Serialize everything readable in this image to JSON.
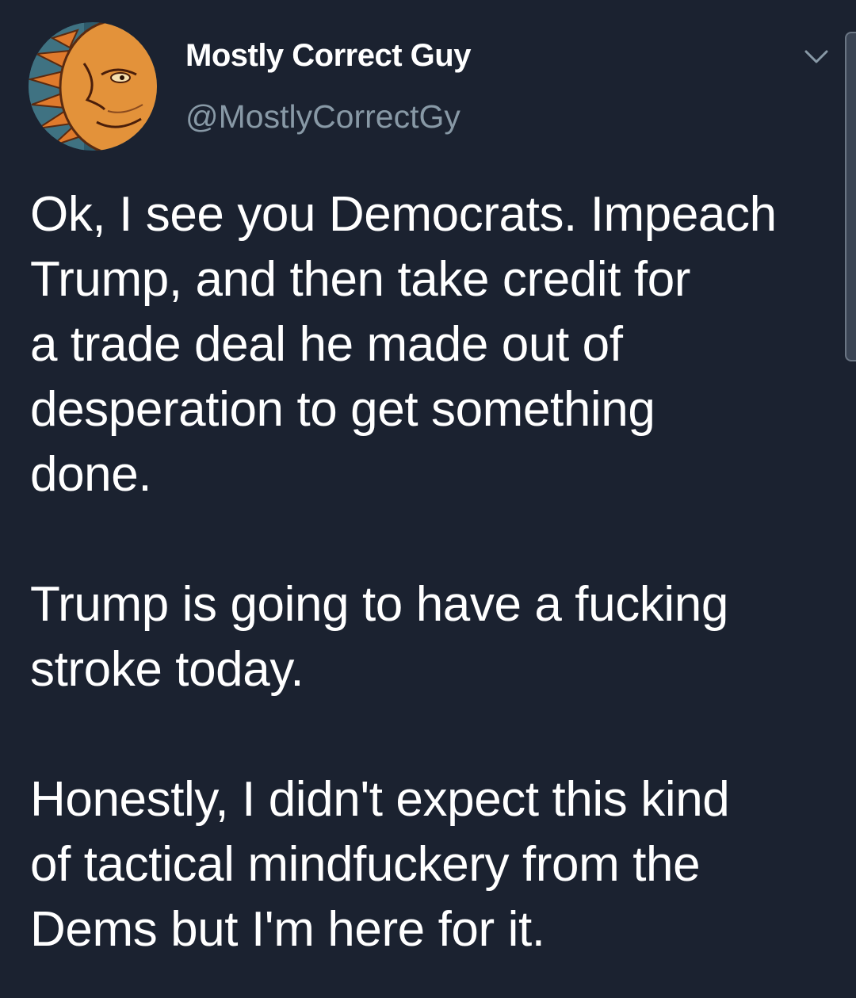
{
  "tweet": {
    "author": {
      "display_name": "Mostly Correct Guy",
      "handle": "@MostlyCorrectGy",
      "avatar_icon": "sun-face-avatar"
    },
    "menu_icon": "chevron-down-icon",
    "paragraphs": [
      {
        "lines": [
          "Ok, I see you Democrats. Impeach",
          "Trump, and then take credit for",
          "a trade deal he made out of",
          "desperation to get something",
          "done."
        ]
      },
      {
        "lines": [
          "Trump is going to have a fucking",
          "stroke today."
        ]
      },
      {
        "lines": [
          "Honestly, I didn't expect this kind",
          "of tactical mindfuckery from the",
          "Dems but I'm here for it."
        ]
      }
    ]
  },
  "colors": {
    "background": "#1b2230",
    "text_primary": "#ffffff",
    "text_secondary": "#8899a6"
  }
}
